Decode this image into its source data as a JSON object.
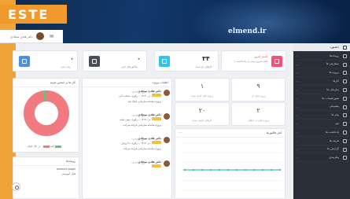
{
  "banner": {
    "watermark": "elmend.ir"
  },
  "brand": {
    "logo_text": "ESTE"
  },
  "topbar": {
    "user_name": "دکتر هادی سجادی"
  },
  "sidebar": {
    "items": [
      {
        "label": "داشبورد",
        "icon": "monitor-icon",
        "active": true
      },
      {
        "label": "رویدادها",
        "icon": "calendar-icon"
      },
      {
        "label": "سفارش ها",
        "icon": "cart-icon"
      },
      {
        "label": "پروژه ها",
        "icon": "folder-icon"
      },
      {
        "label": "کارها",
        "icon": "tasks-icon"
      },
      {
        "label": "سازمان ها",
        "icon": "building-icon"
      },
      {
        "label": "صورتحساب ها",
        "icon": "invoice-icon"
      },
      {
        "label": "پشتیبانی",
        "icon": "support-icon"
      },
      {
        "label": "پیام ها",
        "icon": "message-icon"
      },
      {
        "label": "تیم",
        "icon": "team-icon"
      },
      {
        "label": "یادداشت ها",
        "icon": "note-icon"
      },
      {
        "label": "هزینه ها",
        "icon": "expense-icon"
      },
      {
        "label": "گزارش ها",
        "icon": "report-icon"
      },
      {
        "label": "پیکربندی",
        "icon": "settings-icon"
      }
    ]
  },
  "stats": [
    {
      "value": "۶",
      "label": "جلسه امروز",
      "note": "۶ جلسه امروز بیشتر از ماه گذشته",
      "color": "#ff4d7a",
      "icon": "alarm-icon"
    },
    {
      "value": "۳۴",
      "label": "کارهای باز شما",
      "color": "#2fc3f0",
      "icon": "list-icon"
    },
    {
      "value": "۰",
      "label": "فاکتورهای اخیر",
      "color": "#4a4e5a",
      "icon": "invoice-icon"
    },
    {
      "value": "۰",
      "label": "پیام جدید",
      "color": "#4a8fe3",
      "icon": "send-icon"
    }
  ],
  "mini_stats": [
    {
      "value": "۹",
      "label": "پروژه های باز"
    },
    {
      "value": "۱",
      "label": "پروژه های کامل شده"
    },
    {
      "value": "۲",
      "label": "پروژه های در انتظار"
    },
    {
      "value": "۲۰",
      "label": "کارهای تکمیل شده"
    }
  ],
  "activity": {
    "title": "اعلانات پروژه",
    "items": [
      {
        "name": "دکتر هادی سجادی",
        "date": "دیروز در ۱۵:۳۷",
        "line1": "در ۱۴:۳۰ ...رکورد، منتخب آبی",
        "line2": "پروژه سامانه سازمانی ایجاد شد"
      },
      {
        "name": "دکتر هادی سجادی",
        "date": "دیروز در ۱۵:۳۷",
        "line1": "در ۱۴:۳۰ ...رکورد، پیش نمایه",
        "line2": "پروژه سامانه سازمانی فرایند شرکت"
      },
      {
        "name": "دکتر هادی سجادی",
        "date": "دیروز در ۱۵:۳۷",
        "line1": "در ۱۴:۳۰ ...رکورد، با ارزش",
        "line2": "پروژه سامانه سازمانی فرایند شرکت"
      },
      {
        "name": "دکتر هادی سجادی",
        "date": "دیروز در ۱۵:۳۷",
        "line1": "",
        "line2": ""
      }
    ]
  },
  "donut": {
    "title": "کار ها بر اساس هزینه",
    "legend": [
      "آماده",
      "در حال انجام"
    ],
    "colors": [
      "#f07a7f",
      "#66c57a"
    ]
  },
  "line_chart": {
    "title": "آمار فاکتورها",
    "line_color": "#14b3ad"
  },
  "docs": {
    "title": "رویدادها",
    "items": [
      {
        "text": "research paper"
      },
      {
        "text": "فایل آموزشی"
      }
    ]
  }
}
